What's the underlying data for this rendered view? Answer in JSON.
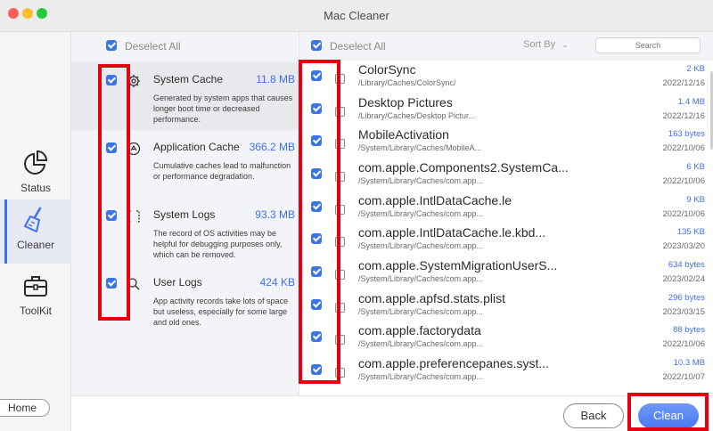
{
  "window": {
    "title": "Mac Cleaner"
  },
  "sidebar": {
    "items": [
      {
        "label": "Status",
        "icon": "pie-chart-icon"
      },
      {
        "label": "Cleaner",
        "icon": "broom-icon"
      },
      {
        "label": "ToolKit",
        "icon": "toolbox-icon"
      }
    ],
    "home_label": "Home"
  },
  "categories_panel": {
    "deselect_label": "Deselect All",
    "items": [
      {
        "name": "System Cache",
        "size": "11.8 MB",
        "description": "Generated by system apps that causes longer boot time or decreased performance.",
        "checked": true,
        "icon": "gear-icon"
      },
      {
        "name": "Application Cache",
        "size": "366.2 MB",
        "description": "Cumulative caches lead to malfunction or performance degradation.",
        "checked": true,
        "icon": "app-icon"
      },
      {
        "name": "System Logs",
        "size": "93.3 MB",
        "description": "The record of OS activities may be helpful for debugging purposes only, which can be removed.",
        "checked": true,
        "icon": "bracket-icon"
      },
      {
        "name": "User Logs",
        "size": "424 KB",
        "description": "App activity records take lots of space but useless, especially for some large and old ones.",
        "checked": true,
        "icon": "search-icon"
      }
    ]
  },
  "files_panel": {
    "deselect_label": "Deselect All",
    "sort_label": "Sort By",
    "search_placeholder": "Search",
    "files": [
      {
        "name": "ColorSync",
        "path": "/Library/Caches/ColorSync/",
        "size": "2 KB",
        "date": "2022/12/16"
      },
      {
        "name": "Desktop Pictures",
        "path": "/Library/Caches/Desktop Pictur...",
        "size": "1.4 MB",
        "date": "2022/12/16"
      },
      {
        "name": "MobileActivation",
        "path": "/System/Library/Caches/MobileA...",
        "size": "163 bytes",
        "date": "2022/10/06"
      },
      {
        "name": "com.apple.Components2.SystemCa...",
        "path": "/System/Library/Caches/com.app...",
        "size": "6 KB",
        "date": "2022/10/06"
      },
      {
        "name": "com.apple.IntlDataCache.le",
        "path": "/System/Library/Caches/com.app...",
        "size": "9 KB",
        "date": "2022/10/06"
      },
      {
        "name": "com.apple.IntlDataCache.le.kbd...",
        "path": "/System/Library/Caches/com.app...",
        "size": "135 KB",
        "date": "2023/03/20"
      },
      {
        "name": "com.apple.SystemMigrationUserS...",
        "path": "/System/Library/Caches/com.app...",
        "size": "634 bytes",
        "date": "2023/02/24"
      },
      {
        "name": "com.apple.apfsd.stats.plist",
        "path": "/System/Library/Caches/com.app...",
        "size": "296 bytes",
        "date": "2023/03/15"
      },
      {
        "name": "com.apple.factorydata",
        "path": "/System/Library/Caches/com.app...",
        "size": "88 bytes",
        "date": "2022/10/06"
      },
      {
        "name": "com.apple.preferencepanes.syst...",
        "path": "/System/Library/Caches/com.app...",
        "size": "10.3 MB",
        "date": "2022/10/07"
      }
    ]
  },
  "footer": {
    "back_label": "Back",
    "clean_label": "Clean"
  },
  "colors": {
    "accent": "#3e6ff2",
    "checkbox": "#3a74e8",
    "highlight": "#e4000f"
  }
}
